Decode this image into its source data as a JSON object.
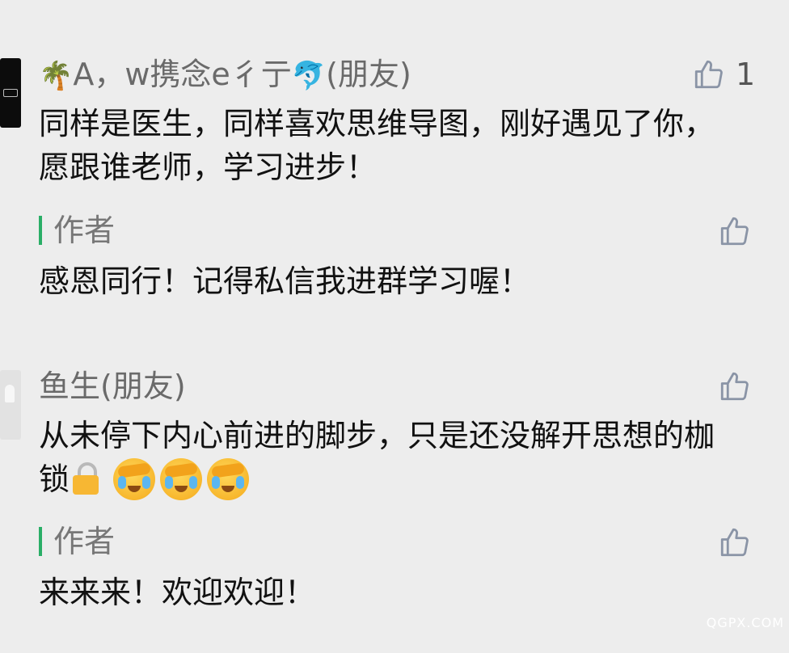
{
  "comments": [
    {
      "user": "A，w携念e彳亍",
      "user_prefix_emoji": "🌴",
      "user_suffix_emoji": "🐬",
      "relation": "(朋友)",
      "text": "同样是医生，同样喜欢思维导图，刚好遇见了你，愿跟谁老师，学习进步！",
      "like_count": "1",
      "reply": {
        "label": "作者",
        "text": "感恩同行！记得私信我进群学习喔！"
      }
    },
    {
      "user": "鱼生(朋友)",
      "text": "从未停下内心前进的脚步，只是还没解开思想的枷锁",
      "reply": {
        "label": "作者",
        "text": "来来来！欢迎欢迎！"
      }
    }
  ],
  "icons": {
    "like": "thumbs-up-outline-icon",
    "lock": "lock-icon",
    "face_palm": "face-palm-crying-icon"
  },
  "colors": {
    "background": "#ededed",
    "author_bar": "#2aae67",
    "username": "#6a6a6a",
    "like_icon": "#8a94a6"
  },
  "watermark": "QGPX.COM"
}
